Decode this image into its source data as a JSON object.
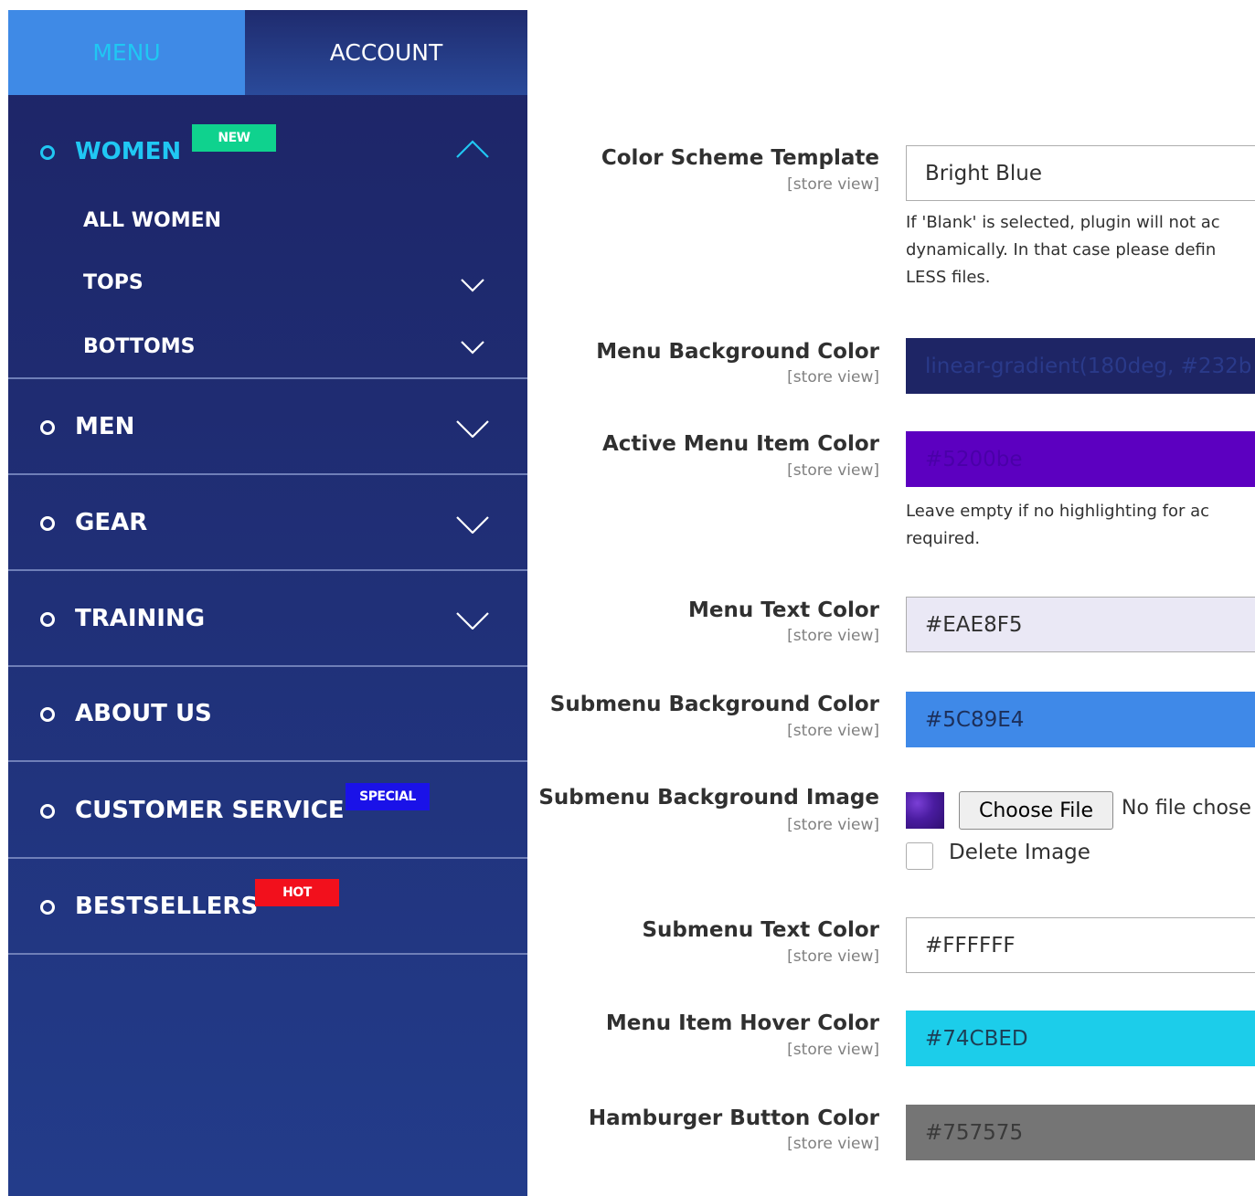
{
  "menu_panel": {
    "tabs": {
      "menu": "MENU",
      "account": "ACCOUNT"
    },
    "items": [
      {
        "label": "WOMEN",
        "badge": "NEW",
        "badge_color": "#0fd28e",
        "expanded": true,
        "children": [
          {
            "label": "ALL WOMEN"
          },
          {
            "label": "TOPS"
          },
          {
            "label": "BOTTOMS"
          }
        ]
      },
      {
        "label": "MEN"
      },
      {
        "label": "GEAR"
      },
      {
        "label": "TRAINING"
      },
      {
        "label": "ABOUT US"
      },
      {
        "label": "CUSTOMER SERVICE",
        "badge": "SPECIAL",
        "badge_color": "#1a12e8"
      },
      {
        "label": "BESTSELLERS",
        "badge": "HOT",
        "badge_color": "#f2101c"
      }
    ],
    "colors": {
      "active_item": "#20c7f3",
      "tab_active_bg": "#3f8ae6"
    }
  },
  "config_form": {
    "fields": [
      {
        "label": "Color Scheme Template",
        "scope": "[store view]",
        "value": "Bright Blue",
        "note": [
          "If 'Blank' is selected, plugin will not ac",
          "dynamically. In that case please defin",
          "LESS files."
        ]
      },
      {
        "label": "Menu Background Color",
        "scope": "[store view]",
        "value": "linear-gradient(180deg, #232b",
        "swatch": "#1e2565"
      },
      {
        "label": "Active Menu Item Color",
        "scope": "[store view]",
        "value": "#5200be",
        "swatch": "#5200be",
        "note": [
          "Leave empty if no highlighting for ac",
          "required."
        ]
      },
      {
        "label": "Menu Text Color",
        "scope": "[store view]",
        "value": "#EAE8F5",
        "swatch": "#eae8f5"
      },
      {
        "label": "Submenu Background Color",
        "scope": "[store view]",
        "value": "#5C89E4",
        "swatch": "#3f89e8"
      },
      {
        "label": "Submenu Background Image",
        "scope": "[store view]",
        "button": "Choose File",
        "file_status": "No file chose",
        "delete_label": "Delete Image"
      },
      {
        "label": "Submenu Text Color",
        "scope": "[store view]",
        "value": "#FFFFFF",
        "swatch": "#ffffff"
      },
      {
        "label": "Menu Item Hover Color",
        "scope": "[store view]",
        "value": "#74CBED",
        "swatch": "#1ccdea"
      },
      {
        "label": "Hamburger Button Color",
        "scope": "[store view]",
        "value": "#757575",
        "swatch": "#757575"
      }
    ]
  }
}
